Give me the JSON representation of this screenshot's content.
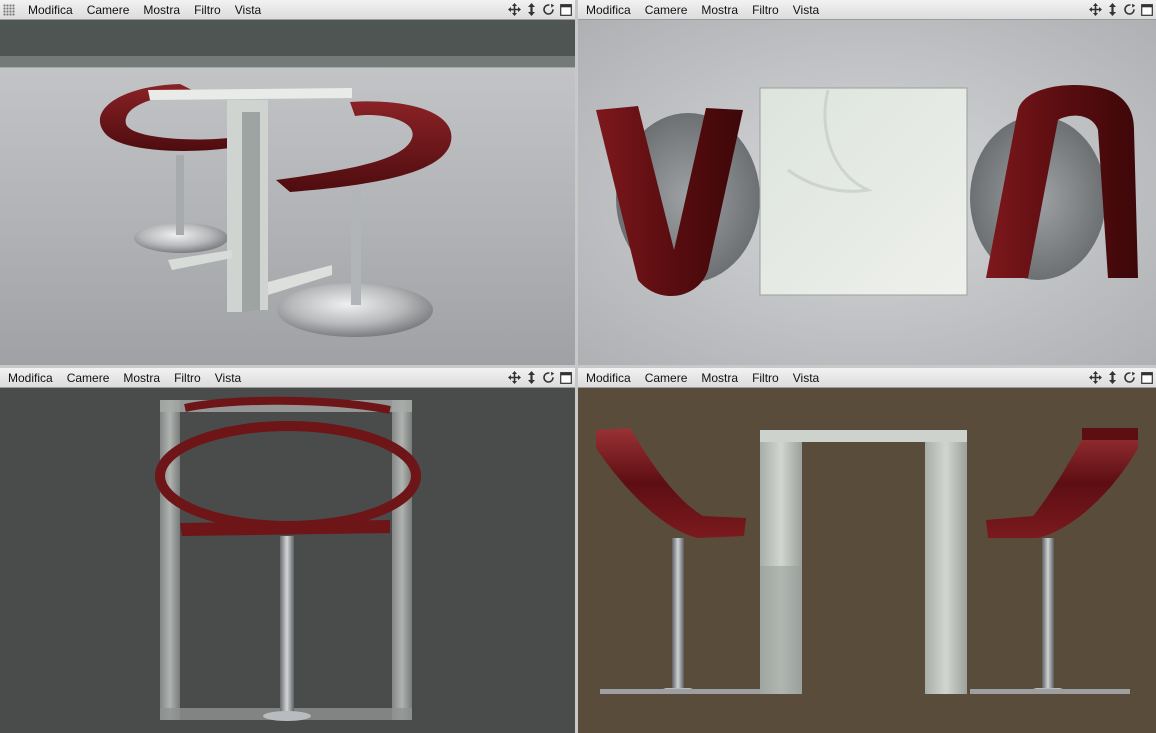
{
  "viewports": [
    {
      "id": "perspective",
      "menus": [
        "Modifica",
        "Camere",
        "Mostra",
        "Filtro",
        "Vista"
      ]
    },
    {
      "id": "top",
      "menus": [
        "Modifica",
        "Camere",
        "Mostra",
        "Filtro",
        "Vista"
      ]
    },
    {
      "id": "right",
      "menus": [
        "Modifica",
        "Camere",
        "Mostra",
        "Filtro",
        "Vista"
      ]
    },
    {
      "id": "front",
      "menus": [
        "Modifica",
        "Camere",
        "Mostra",
        "Filtro",
        "Vista"
      ]
    }
  ],
  "tool_icons": [
    "move-icon",
    "scale-icon",
    "rotate-icon",
    "maximize-icon"
  ],
  "colors": {
    "seat": "#6e1518",
    "metal": "#b9bcbe",
    "table": "#d5dad5",
    "v3_bg": "#4a4b4b",
    "v4_bg": "#5a4c3b"
  }
}
